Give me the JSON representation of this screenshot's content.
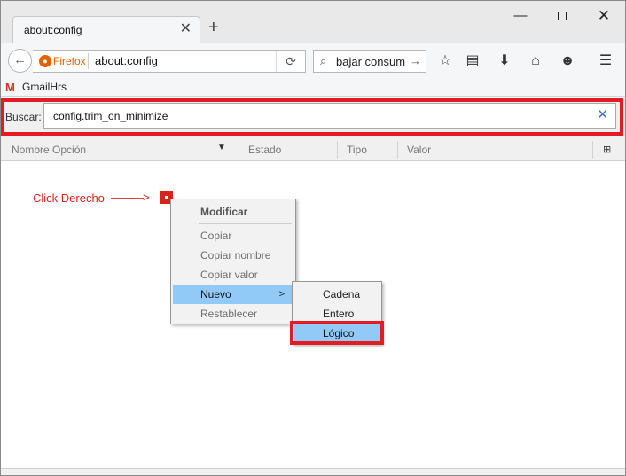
{
  "tab": {
    "title": "about:config"
  },
  "nav": {
    "identity_label": "Firefox",
    "url": "about:config",
    "search_text": "bajar consum"
  },
  "bookmarks": [
    {
      "label": "GmailHrs"
    }
  ],
  "filter": {
    "label": "Buscar:",
    "value": "config.trim_on_minimize"
  },
  "columns": [
    "Nombre Opción",
    "Estado",
    "Tipo",
    "Valor"
  ],
  "annotation": {
    "text": "Click Derecho",
    "arrow": "———>"
  },
  "context_menu": {
    "items": [
      {
        "label": "Modificar"
      },
      {
        "label": "Copiar"
      },
      {
        "label": "Copiar nombre"
      },
      {
        "label": "Copiar valor"
      },
      {
        "label": "Nuevo"
      },
      {
        "label": "Restablecer"
      }
    ]
  },
  "submenu": {
    "items": [
      {
        "label": "Cadena"
      },
      {
        "label": "Entero"
      },
      {
        "label": "Lógico"
      }
    ]
  },
  "colors": {
    "highlight_frame": "#e31b23",
    "menu_highlight": "#91c9f7",
    "firefox_orange": "#e66000"
  },
  "icons": [
    "close-icon",
    "plus-icon",
    "back-arrow-icon",
    "firefox-logo-icon",
    "reload-icon",
    "search-icon",
    "star-icon",
    "reading-list-icon",
    "download-icon",
    "home-icon",
    "smiley-icon",
    "hamburger-menu-icon",
    "gmail-icon",
    "clear-icon",
    "column-picker-icon"
  ]
}
